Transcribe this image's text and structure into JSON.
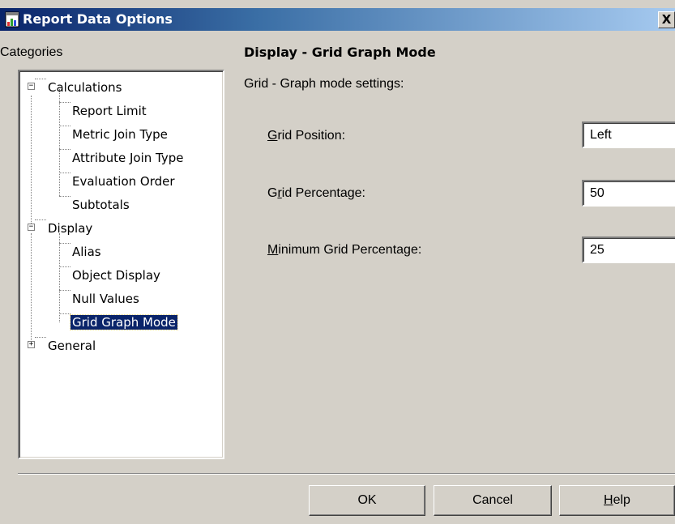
{
  "window": {
    "title": "Report Data Options",
    "close_label": "X"
  },
  "categories_label": "Categories",
  "tree": {
    "calculations": {
      "label": "Calculations",
      "expander": "−",
      "children": [
        "Report Limit",
        "Metric Join Type",
        "Attribute Join Type",
        "Evaluation Order",
        "Subtotals"
      ]
    },
    "display": {
      "label": "Display",
      "expander": "−",
      "children": [
        "Alias",
        "Object Display",
        "Null Values",
        "Grid Graph Mode"
      ]
    },
    "general": {
      "label": "General",
      "expander": "+"
    },
    "selected": "Grid Graph Mode"
  },
  "section": {
    "title": "Display - Grid Graph Mode",
    "subtitle": "Grid - Graph mode settings:"
  },
  "fields": {
    "grid_position": {
      "label_mnemonic": "G",
      "label_rest": "rid Position:",
      "value": "Left"
    },
    "grid_percentage": {
      "label_pre": "G",
      "label_mnemonic": "r",
      "label_rest": "id Percentage:",
      "value": "50"
    },
    "minimum_grid_percentage": {
      "label_mnemonic": "M",
      "label_rest": "inimum Grid Percentage:",
      "value": "25"
    }
  },
  "buttons": {
    "ok": "OK",
    "cancel": "Cancel",
    "help_mnemonic": "H",
    "help_rest": "elp"
  },
  "icons": {
    "app": "report-icon",
    "close": "close-icon",
    "expand": "plus-box-icon",
    "collapse": "minus-box-icon"
  },
  "colors": {
    "titlebar_start": "#0a246a",
    "titlebar_end": "#a6caf0",
    "selection": "#0a246a",
    "face": "#d4d0c8"
  }
}
